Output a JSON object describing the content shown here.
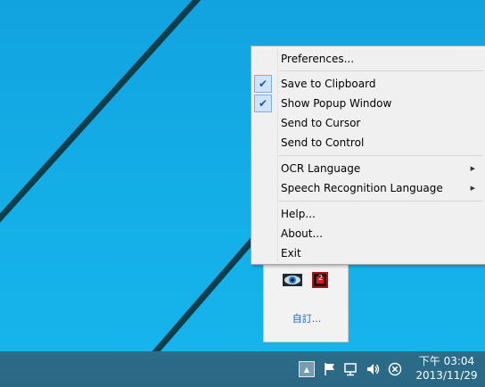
{
  "context_menu": {
    "items": [
      {
        "label": "Preferences...",
        "checked": false,
        "submenu": false
      },
      {
        "label": "Save to Clipboard",
        "checked": true,
        "submenu": false
      },
      {
        "label": "Show Popup Window",
        "checked": true,
        "submenu": false
      },
      {
        "label": "Send to Cursor",
        "checked": false,
        "submenu": false
      },
      {
        "label": "Send to Control",
        "checked": false,
        "submenu": false
      },
      {
        "label": "OCR Language",
        "checked": false,
        "submenu": true
      },
      {
        "label": "Speech Recognition Language",
        "checked": false,
        "submenu": true
      },
      {
        "label": "Help...",
        "checked": false,
        "submenu": false
      },
      {
        "label": "About...",
        "checked": false,
        "submenu": false
      },
      {
        "label": "Exit",
        "checked": false,
        "submenu": false
      }
    ],
    "check_glyph": "✔",
    "submenu_glyph": "▶"
  },
  "tray_overflow": {
    "icons": [
      "eye-app-icon",
      "red-square-app-icon"
    ],
    "badge": "2",
    "customize_label": "自訂..."
  },
  "taskbar": {
    "show_hidden_glyph": "▲",
    "icons": [
      "flag-icon",
      "network-icon",
      "volume-icon",
      "x-circle-icon"
    ],
    "clock": {
      "time": "下午 03:04",
      "date": "2013/11/29"
    }
  },
  "colors": {
    "desktop": "#14aee7",
    "taskbar": "#2b6985",
    "menu_bg": "#f0f0f0",
    "check_bg": "#cfe4f8",
    "link": "#1e63b3"
  }
}
